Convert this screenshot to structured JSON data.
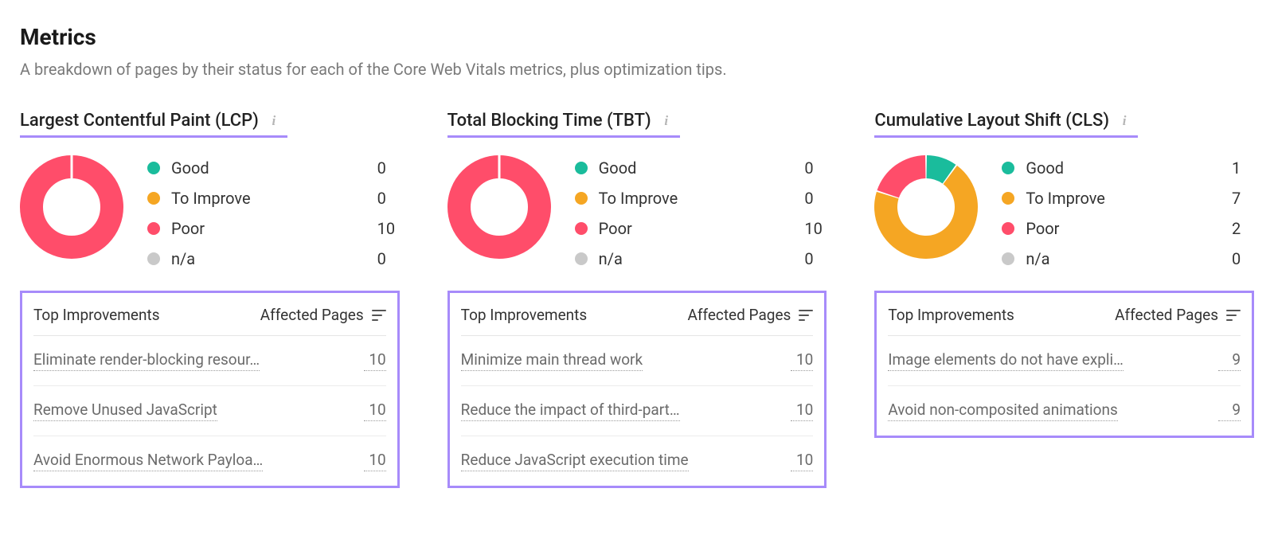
{
  "header": {
    "title": "Metrics",
    "description": "A breakdown of pages by their status for each of the Core Web Vitals metrics, plus optimization tips."
  },
  "colors": {
    "good": "#1abc9c",
    "to_improve": "#f5a623",
    "poor": "#ff4d6a",
    "na": "#c9c9c9",
    "accent": "#a78bfa"
  },
  "legend_labels": {
    "good": "Good",
    "to_improve": "To Improve",
    "poor": "Poor",
    "na": "n/a"
  },
  "table_headers": {
    "improvements": "Top Improvements",
    "affected": "Affected Pages"
  },
  "cards": [
    {
      "id": "lcp",
      "title": "Largest Contentful Paint (LCP)",
      "values": {
        "good": 0,
        "to_improve": 0,
        "poor": 10,
        "na": 0
      },
      "improvements": [
        {
          "name": "Eliminate render-blocking resour…",
          "count": 10
        },
        {
          "name": "Remove Unused JavaScript",
          "count": 10
        },
        {
          "name": "Avoid Enormous Network Payloa…",
          "count": 10
        }
      ]
    },
    {
      "id": "tbt",
      "title": "Total Blocking Time (TBT)",
      "values": {
        "good": 0,
        "to_improve": 0,
        "poor": 10,
        "na": 0
      },
      "improvements": [
        {
          "name": "Minimize main thread work",
          "count": 10
        },
        {
          "name": "Reduce the impact of third-part…",
          "count": 10
        },
        {
          "name": "Reduce JavaScript execution time",
          "count": 10
        }
      ]
    },
    {
      "id": "cls",
      "title": "Cumulative Layout Shift (CLS)",
      "values": {
        "good": 1,
        "to_improve": 7,
        "poor": 2,
        "na": 0
      },
      "improvements": [
        {
          "name": "Image elements do not have expli…",
          "count": 9
        },
        {
          "name": "Avoid non-composited animations",
          "count": 9
        }
      ]
    }
  ],
  "chart_data": [
    {
      "type": "pie",
      "title": "Largest Contentful Paint (LCP)",
      "categories": [
        "Good",
        "To Improve",
        "Poor",
        "n/a"
      ],
      "values": [
        0,
        0,
        10,
        0
      ]
    },
    {
      "type": "pie",
      "title": "Total Blocking Time (TBT)",
      "categories": [
        "Good",
        "To Improve",
        "Poor",
        "n/a"
      ],
      "values": [
        0,
        0,
        10,
        0
      ]
    },
    {
      "type": "pie",
      "title": "Cumulative Layout Shift (CLS)",
      "categories": [
        "Good",
        "To Improve",
        "Poor",
        "n/a"
      ],
      "values": [
        1,
        7,
        2,
        0
      ]
    }
  ]
}
